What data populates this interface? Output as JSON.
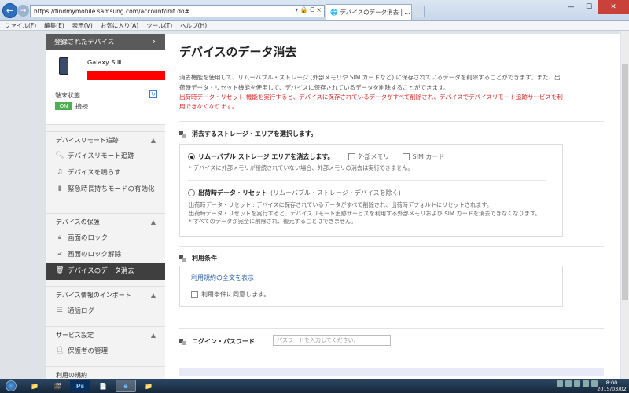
{
  "browser": {
    "url": "https://findmymobile.samsung.com/account/init.do#",
    "tab_title": "デバイスのデータ消去 | ...",
    "address_controls": "▾ 🔒 C ×",
    "menu": [
      "ファイル(F)",
      "編集(E)",
      "表示(V)",
      "お気に入り(A)",
      "ツール(T)",
      "ヘルプ(H)"
    ]
  },
  "sidebar": {
    "header": "登録されたデバイス",
    "device_name": "Galaxy S Ⅲ",
    "status_label": "端末状態",
    "status_badge": "ON",
    "status_text": "接続",
    "sections": [
      {
        "title": "デバイスリモート追跡",
        "items": [
          "デバイスリモート追跡",
          "デバイスを鳴らす",
          "緊急時長持ちモードの有効化"
        ]
      },
      {
        "title": "デバイスの保護",
        "items": [
          "画面のロック",
          "画面のロック解除",
          "デバイスのデータ消去"
        ]
      },
      {
        "title": "デバイス情報のインポート",
        "items": [
          "通話ログ"
        ]
      },
      {
        "title": "サービス設定",
        "items": [
          "保護者の管理"
        ]
      }
    ],
    "bottom_section": "利用の規約"
  },
  "main": {
    "title": "デバイスのデータ消去",
    "desc_line1": "消去機能を使用して、リムーバブル・ストレージ (外部メモリや SIM カードなど) に保存されているデータを削除することができます。また、出",
    "desc_line2": "荷時データ・リセット機能を使用して、デバイスに保存されているデータを削除することができます。",
    "warning_line1": "出荷時データ・リセット 機能を実行すると、デバイスに保存されているデータがすべて削除され、デバイスでデバイスリモート追跡サービスを利",
    "warning_line2": "用できなくなります。",
    "storage_section_title": "消去するストレージ・エリアを選択します。",
    "option1_label": "リムーバブル ストレージ エリアを消去します。",
    "option1_cb1": "外部メモリ",
    "option1_cb2": "SIM カード",
    "option1_note": "* デバイスに外部メモリが接続されていない場合、外部メモリの消去は実行できません。",
    "option2_label_bold": "出荷時データ・リセット",
    "option2_label_rest": "(リムーバブル・ストレージ・デバイスを除く)",
    "option2_note1": "出荷時データ・リセット : デバイスに保存されているデータがすべて削除され、出荷時デフォルトにリセットされます。",
    "option2_note2": "出荷時データ・リセットを実行すると、デバイスリモート追跡サービスを利用する外部メモリおよび SIM カードを消去できなくなります。",
    "option2_note3": "* すべてのデータが完全に削除され、復元することはできません。",
    "terms_title": "利用条件",
    "terms_link": "利用規約の全文を表示",
    "terms_agree": "利用条件に同意します。",
    "login_title": "ログイン・パスワード",
    "password_placeholder": "パスワードを入力してください。"
  },
  "taskbar": {
    "apps": [
      "📁",
      "🎬",
      "Ps",
      "📄",
      "e",
      "📁"
    ],
    "time": "8:00",
    "date": "2015/03/02"
  }
}
